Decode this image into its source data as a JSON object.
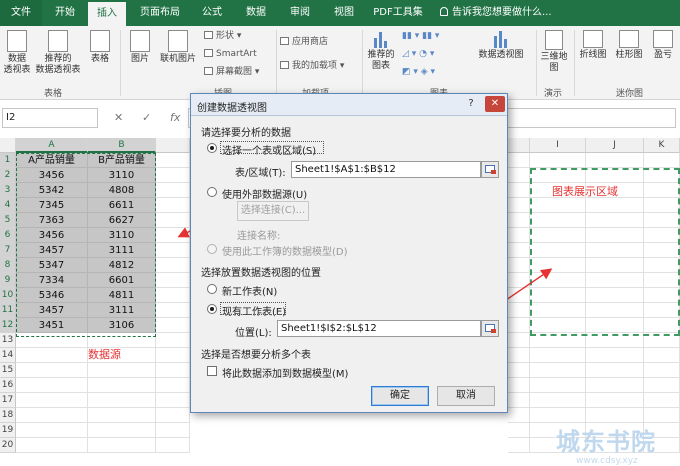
{
  "ribbon": {
    "tabs": [
      "文件",
      "开始",
      "插入",
      "页面布局",
      "公式",
      "数据",
      "审阅",
      "视图",
      "PDF工具集"
    ],
    "active_tab": "插入",
    "tell_me": "告诉我您想要做什么...",
    "buttons": {
      "pivot_table": "数据\n透视表",
      "recommended_pivot": "推荐的\n数据透视表",
      "table": "表格",
      "pictures": "图片",
      "online_pictures": "联机图片",
      "shapes": "形状",
      "smartart": "SmartArt",
      "screenshot": "屏幕截图",
      "store": "应用商店",
      "my_addins": "我的加载项",
      "recommended_charts": "推荐的\n图表",
      "pivot_chart": "数据透视图",
      "map_3d": "三维地\n图",
      "line": "折线图",
      "column": "柱形图",
      "win_loss": "盈亏"
    },
    "groups": {
      "tables": "表格",
      "illustrations": "插图",
      "addins": "加载项",
      "charts": "图表",
      "tours": "演示",
      "sparklines": "迷你图"
    }
  },
  "formula_bar": {
    "name_box": "I2",
    "cancel": "✕",
    "confirm": "✓",
    "fx": "fx",
    "formula": ""
  },
  "sheet": {
    "columns": [
      "A",
      "B",
      "",
      "",
      "",
      "",
      "",
      "",
      "I",
      "J",
      "K"
    ],
    "rows": [
      "1",
      "2",
      "3",
      "4",
      "5",
      "6",
      "7",
      "8",
      "9",
      "10",
      "11",
      "12",
      "13",
      "14",
      "15",
      "16",
      "17",
      "18",
      "19",
      "20"
    ],
    "header": [
      "A产品销量",
      "B产品销量"
    ],
    "data": [
      [
        "3456",
        "3110"
      ],
      [
        "5342",
        "4808"
      ],
      [
        "7345",
        "6611"
      ],
      [
        "7363",
        "6627"
      ],
      [
        "3456",
        "3110"
      ],
      [
        "3457",
        "3111"
      ],
      [
        "5347",
        "4812"
      ],
      [
        "7334",
        "6601"
      ],
      [
        "5346",
        "4811"
      ],
      [
        "3457",
        "3111"
      ],
      [
        "3451",
        "3106"
      ]
    ],
    "annotation_source": "数据源",
    "annotation_chart": "图表展示区域",
    "watermark": "城东书院",
    "watermark_url": "www.cdsy.xyz",
    "annotation_color": "#e63232"
  },
  "dialog": {
    "title": "创建数据透视图",
    "help": "?",
    "close": "✕",
    "section_data": "请选择要分析的数据",
    "opt_select_table": "选择一个表或区域(S)",
    "table_range_label": "表/区域(T):",
    "table_range_value": "Sheet1!$A$1:$B$12",
    "opt_external": "使用外部数据源(U)",
    "choose_connection": "选择连接(C)...",
    "connection_name": "连接名称:",
    "opt_data_model": "使用此工作簿的数据模型(D)",
    "section_location": "选择放置数据透视图的位置",
    "opt_new_sheet": "新工作表(N)",
    "opt_existing_sheet": "现有工作表(E)",
    "location_label": "位置(L):",
    "location_value": "Sheet1!$I$2:$L$12",
    "section_multi": "选择是否想要分析多个表",
    "add_to_model": "将此数据添加到数据模型(M)",
    "ok": "确定",
    "cancel": "取消"
  },
  "colors": {
    "excel_green": "#217346",
    "selection_fill": "#c6c6c6",
    "chart_area_border": "#3f9b62"
  }
}
